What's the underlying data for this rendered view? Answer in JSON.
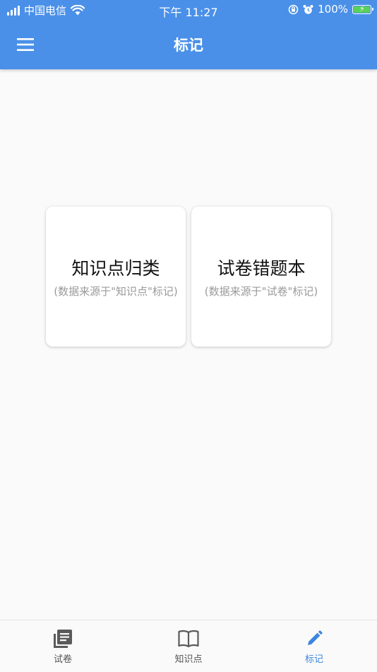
{
  "status_bar": {
    "carrier": "中国电信",
    "time": "下午 11:27",
    "battery": "100%"
  },
  "app_bar": {
    "title": "标记"
  },
  "cards": [
    {
      "title": "知识点归类",
      "subtitle": "(数据来源于\"知识点\"标记)"
    },
    {
      "title": "试卷错题本",
      "subtitle": "(数据来源于\"试卷\"标记)"
    }
  ],
  "bottom_nav": [
    {
      "label": "试卷",
      "icon": "article-icon"
    },
    {
      "label": "知识点",
      "icon": "book-icon"
    },
    {
      "label": "标记",
      "icon": "pencil-icon",
      "active": true
    }
  ],
  "colors": {
    "primary": "#4a90e8",
    "active_tab": "#3b86e0",
    "background": "#fafafa"
  }
}
